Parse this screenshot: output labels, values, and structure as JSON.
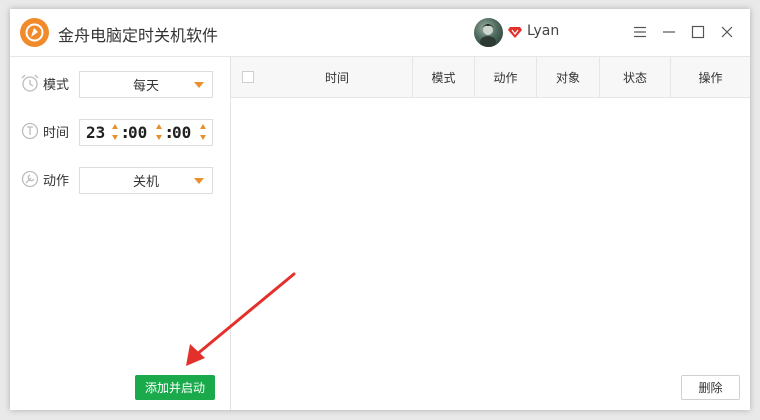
{
  "window": {
    "title": "金舟电脑定时关机软件",
    "user": {
      "name": "Lyan"
    }
  },
  "settings": {
    "mode": {
      "label": "模式",
      "value": "每天",
      "icon": "alarm-clock-icon"
    },
    "time": {
      "label": "时间",
      "hour": "23",
      "minute": "00",
      "second": "00",
      "icon": "timer-icon"
    },
    "action": {
      "label": "动作",
      "value": "关机",
      "icon": "wrench-icon"
    },
    "add_button": "添加并启动"
  },
  "table": {
    "columns": [
      "时间",
      "模式",
      "动作",
      "对象",
      "状态",
      "操作"
    ],
    "rows": [],
    "delete_button": "删除"
  },
  "colors": {
    "accent": "#e8902a",
    "add_button": "#1aaa4b",
    "annotation_arrow": "#e3302b"
  }
}
